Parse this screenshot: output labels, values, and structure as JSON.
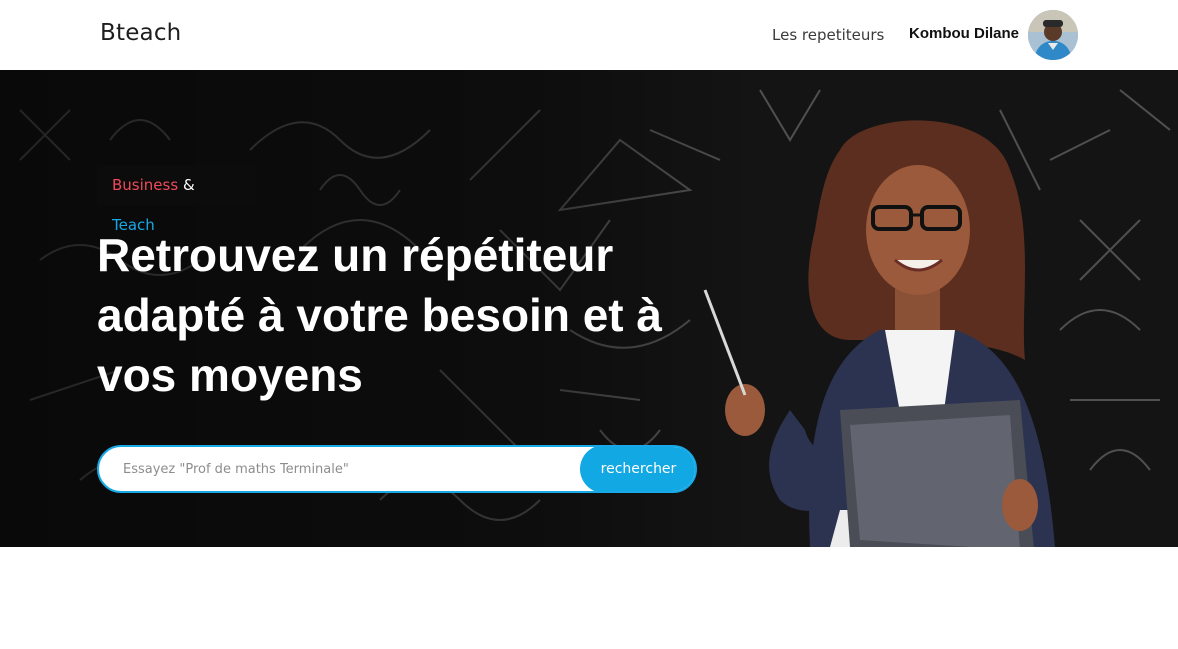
{
  "navbar": {
    "brand": "Bteach",
    "link_tutors": "Les repetiteurs",
    "user_name": "Kombou Dilane",
    "avatar_icon": "user-avatar-icon"
  },
  "hero": {
    "tagline": {
      "business": "Business",
      "amp": "&",
      "teach": "Teach"
    },
    "headline": "Retrouvez un répétiteur adapté à votre besoin et à vos moyens",
    "search": {
      "placeholder": "Essayez \"Prof de maths Terminale\"",
      "value": "",
      "button_label": "rechercher"
    }
  },
  "colors": {
    "accent": "#16a9e6",
    "business_red": "#ef4a5a",
    "hero_background": "#141414",
    "navbar_background": "#ffffff"
  }
}
